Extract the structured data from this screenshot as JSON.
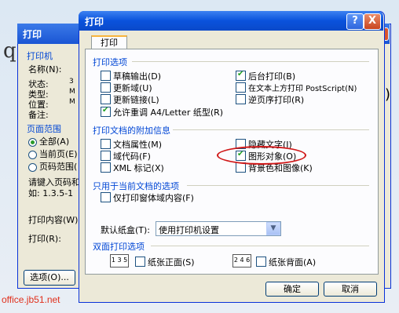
{
  "background": {
    "doc_letter": "q",
    "right_paren": ")"
  },
  "back_dialog": {
    "title": "打印",
    "printer_group": "打印机",
    "name_label": "名称(N):",
    "status_label": "状态:",
    "type_label": "类型:",
    "location_label": "位置:",
    "comment_label": "备注:",
    "status_value": "3",
    "type_value": "M",
    "location_value": "M",
    "range_group": "页面范围",
    "range_all": "全部(A)",
    "range_current": "当前页(E)",
    "range_pages": "页码范围(",
    "hint_line1": "请键入页码和",
    "hint_line2": "如: 1.3.5-1",
    "print_content_label": "打印内容(W):",
    "print_label": "打印(R):",
    "options_button": "选项(O)..."
  },
  "dialog": {
    "title": "打印",
    "help_button": "?",
    "close_button": "X",
    "tab_print": "打印",
    "section_print_options": "打印选项",
    "draft_output": "草稿输出(D)",
    "update_fields": "更新域(U)",
    "update_links": "更新链接(L)",
    "allow_a4_letter": "允许重调 A4/Letter 纸型(R)",
    "background_printing": "后台打印(B)",
    "postscript_over_text": "在文本上方打印 PostScript(N)",
    "reverse_order": "逆页序打印(R)",
    "section_additional": "打印文档的附加信息",
    "document_properties": "文档属性(M)",
    "field_codes": "域代码(F)",
    "xml_tags": "XML 标记(X)",
    "hidden_text": "隐藏文字(I)",
    "drawing_objects": "图形对象(O)",
    "background_colors": "背景色和图像(K)",
    "section_current_doc": "只用于当前文档的选项",
    "print_form_data_only": "仅打印窗体域内容(F)",
    "default_tray_label": "默认纸盒(T):",
    "default_tray_value": "使用打印机设置",
    "section_duplex": "双面打印选项",
    "front_of_sheet": "纸张正面(S)",
    "back_of_sheet": "纸张背面(A)",
    "front_icon_text": "1 3 5",
    "back_icon_text": "2 4 6",
    "ok_button": "确定",
    "cancel_button": "取消"
  },
  "checkbox_state": {
    "draft_output": false,
    "update_fields": false,
    "update_links": false,
    "allow_a4_letter": true,
    "background_printing": true,
    "postscript_over_text": false,
    "reverse_order": false,
    "document_properties": false,
    "field_codes": false,
    "xml_tags": false,
    "hidden_text": false,
    "drawing_objects": true,
    "background_colors": false,
    "print_form_data_only": false,
    "front_of_sheet": false,
    "back_of_sheet": false
  },
  "watermark": "office.jb51.net",
  "colors": {
    "title_bar": "#0a52dc",
    "section_text": "#0046d5",
    "highlight_oval": "#d01818",
    "watermark": "#e0301c"
  }
}
